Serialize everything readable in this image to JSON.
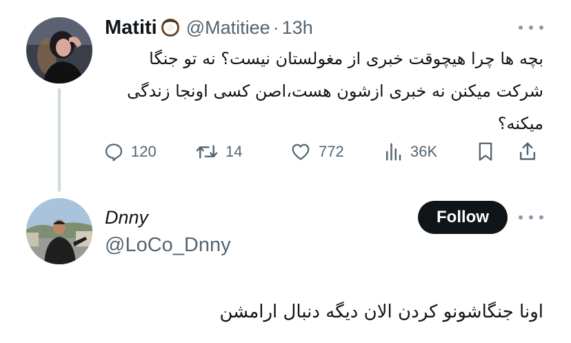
{
  "tweet": {
    "display_name": "Matiti",
    "name_emoji_icon": "coconut-icon",
    "handle": "@Matitiee",
    "separator": "·",
    "time": "13h",
    "text": "بچه ها چرا هیچوقت خبری از مغولستان نیست؟ نه تو جنگا شرکت میکنن نه خبری ازشون هست،اصن کسی اونجا زندگی میکنه؟",
    "actions": {
      "reply": {
        "icon": "reply-icon",
        "count": "120"
      },
      "retweet": {
        "icon": "retweet-icon",
        "count": "14"
      },
      "like": {
        "icon": "heart-icon",
        "count": "772"
      },
      "views": {
        "icon": "views-chart-icon",
        "count": "36K"
      },
      "bookmark": {
        "icon": "bookmark-icon"
      },
      "share": {
        "icon": "share-icon"
      }
    }
  },
  "reply": {
    "display_name": "Dnny",
    "handle": "@LoCo_Dnny",
    "follow_label": "Follow",
    "text": "اونا جنگاشونو کردن الان دیگه دنبال ارامشن"
  },
  "colors": {
    "primary_text": "#0f1419",
    "secondary_text": "#536471",
    "thread_line": "#cfd9de",
    "follow_bg": "#0f1419",
    "follow_text": "#ffffff"
  }
}
